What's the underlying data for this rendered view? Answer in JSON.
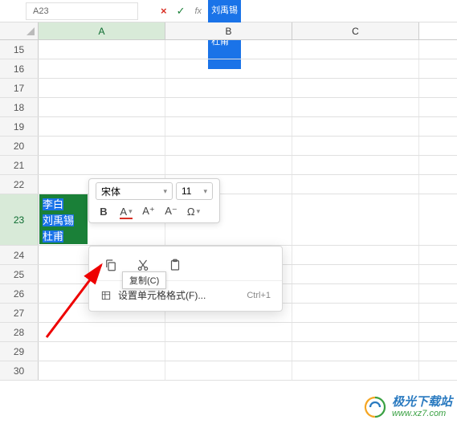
{
  "namebox": "A23",
  "formula_content": [
    "李白",
    "刘禹锡",
    "杜甫"
  ],
  "columns": [
    "A",
    "B",
    "C"
  ],
  "rows": [
    15,
    16,
    17,
    18,
    19,
    20,
    21,
    22,
    23,
    24,
    25,
    26,
    27,
    28,
    29,
    30
  ],
  "selected_row": 23,
  "cell_lines": [
    "李白",
    "刘禹锡",
    "杜甫"
  ],
  "mini": {
    "font": "宋体",
    "size": "11",
    "bold": "B",
    "fontcolor": "A",
    "inc": "A⁺",
    "dec": "A⁻",
    "omega": "Ω"
  },
  "ctx": {
    "copy_tooltip": "复制(C)",
    "format_cells": "设置单元格格式(F)...",
    "format_shortcut": "Ctrl+1"
  },
  "watermark": {
    "title": "极光下载站",
    "url": "www.xz7.com"
  }
}
